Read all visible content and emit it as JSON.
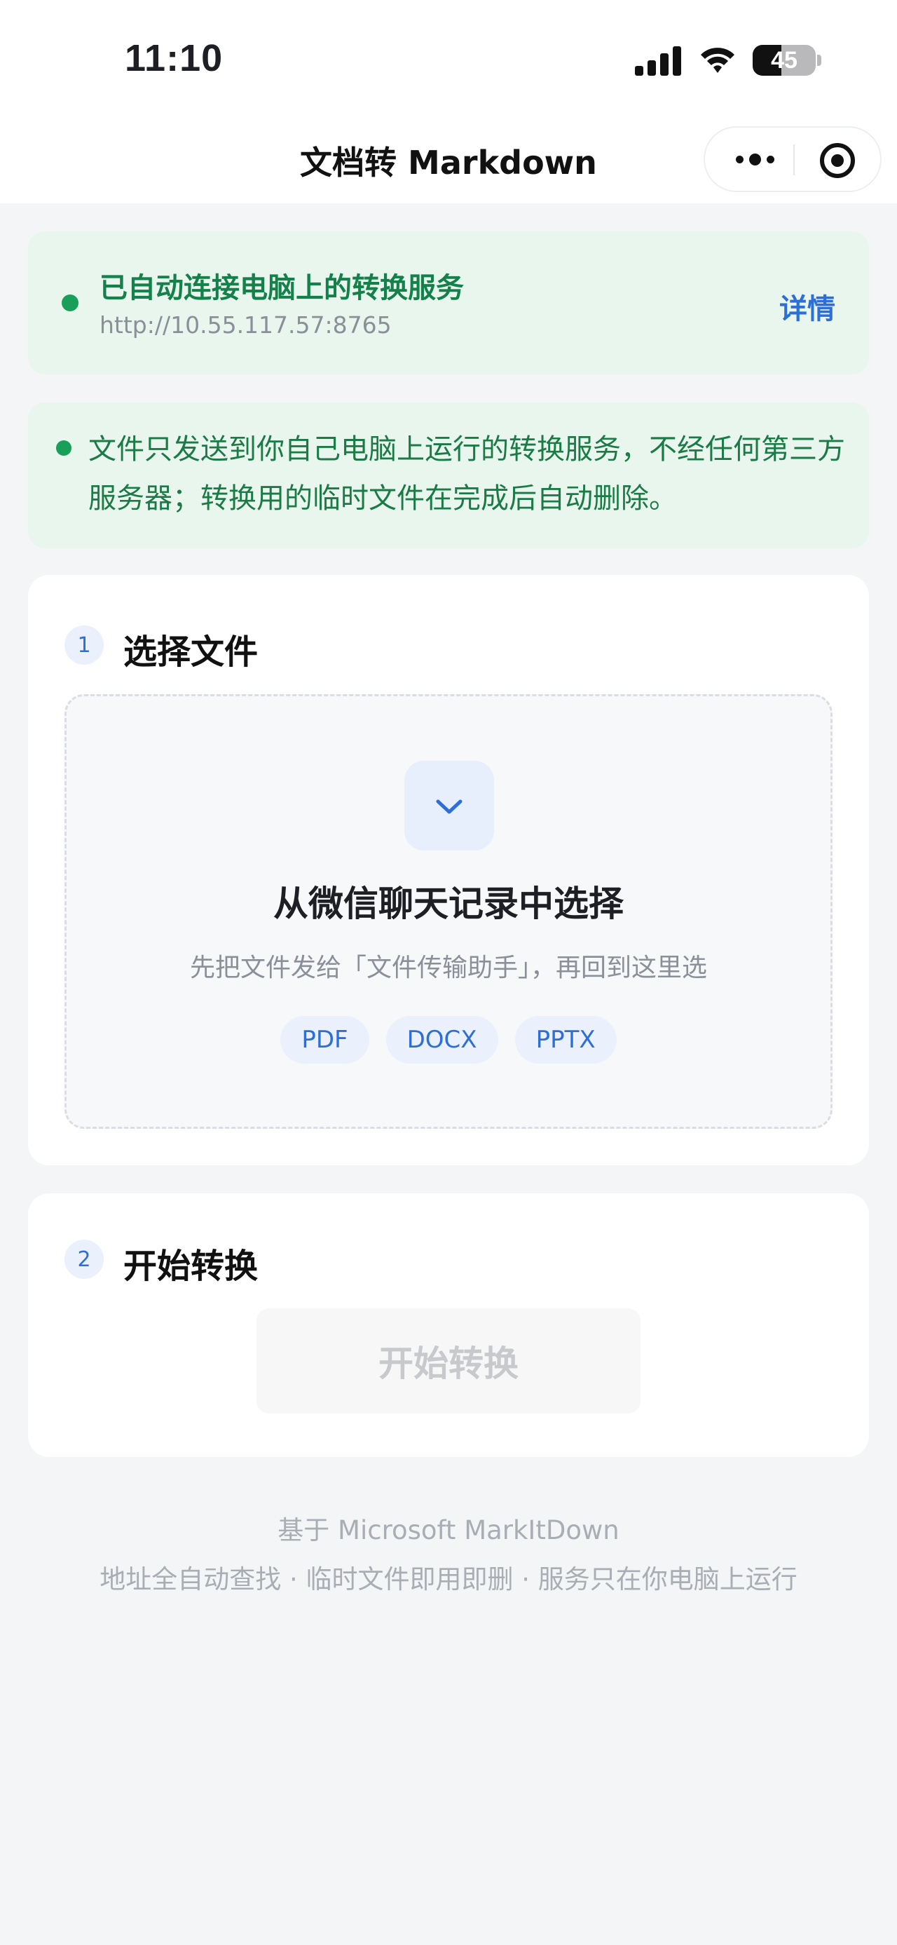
{
  "status_bar": {
    "time": "11:10",
    "battery_level": "45",
    "battery_fraction": 0.45
  },
  "nav": {
    "title": "文档转 Markdown",
    "more_icon": "more-dots-icon",
    "close_icon": "record-circle-icon"
  },
  "connection": {
    "title": "已自动连接电脑上的转换服务",
    "url": "http://10.55.117.57:8765",
    "details_label": "详情",
    "accent": "#18a058"
  },
  "privacy": {
    "text": "文件只发送到你自己电脑上运行的转换服务，不经任何第三方服务器；转换用的临时文件在完成后自动删除。"
  },
  "step1": {
    "number": "1",
    "title": "选择文件",
    "dropzone": {
      "icon": "chevron-down-icon",
      "title": "从微信聊天记录中选择",
      "subtitle": "先把文件发给「文件传输助手」，再回到这里选",
      "formats": [
        "PDF",
        "DOCX",
        "PPTX"
      ]
    }
  },
  "step2": {
    "number": "2",
    "title": "开始转换",
    "button_label": "开始转换"
  },
  "footer": {
    "line1": "基于 Microsoft MarkItDown",
    "line2": "地址全自动查找 · 临时文件即用即删 · 服务只在你电脑上运行"
  }
}
